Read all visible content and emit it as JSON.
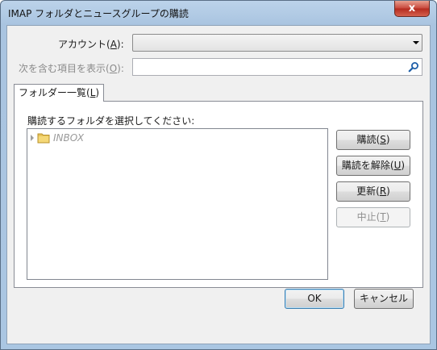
{
  "window": {
    "title": "IMAP フォルダとニュースグループの購読",
    "close_glyph": "x"
  },
  "form": {
    "account_label": "アカウント(",
    "account_accel": "A",
    "account_label_end": "):",
    "account_value": "",
    "filter_label": "次を含む項目を表示(",
    "filter_accel": "O",
    "filter_label_end": "):",
    "filter_value": ""
  },
  "tabs": [
    {
      "label": "フォルダー一覧(",
      "accel": "L",
      "label_end": ")",
      "selected": true
    }
  ],
  "panel": {
    "instruction": "購読するフォルダを選択してください:",
    "tree": [
      {
        "label": "INBOX",
        "icon": "folder-icon",
        "expanded": false
      }
    ]
  },
  "side_buttons": {
    "subscribe": {
      "label": "購読(",
      "accel": "S",
      "label_end": ")"
    },
    "unsubscribe": {
      "label": "購読を解除(",
      "accel": "U",
      "label_end": ")"
    },
    "refresh": {
      "label": "更新(",
      "accel": "R",
      "label_end": ")"
    },
    "stop": {
      "label": "中止(",
      "accel": "T",
      "label_end": ")",
      "disabled": true
    }
  },
  "footer": {
    "ok": "OK",
    "cancel": "キャンセル"
  },
  "colors": {
    "titlebar": "#aac6e2",
    "close_button": "#c7463a",
    "dialog_bg": "#f0f0f0",
    "default_button_border": "#3c7fb1",
    "disabled_text": "#8f8f8f"
  }
}
